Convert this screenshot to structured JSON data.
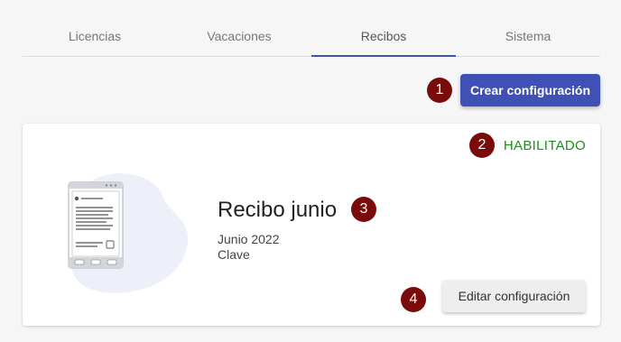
{
  "tabs": [
    {
      "label": "Licencias"
    },
    {
      "label": "Vacaciones"
    },
    {
      "label": "Recibos"
    },
    {
      "label": "Sistema"
    }
  ],
  "toolbar": {
    "create_label": "Crear configuración"
  },
  "card": {
    "status": "HABILITADO",
    "title": "Recibo junio",
    "date": "Junio 2022",
    "subtitle": "Clave",
    "edit_label": "Editar configuración"
  },
  "markers": [
    "1",
    "2",
    "3",
    "4"
  ],
  "colors": {
    "accent": "#3f51b5",
    "status_enabled": "#1e8e1e",
    "marker": "#7a0b0b"
  }
}
